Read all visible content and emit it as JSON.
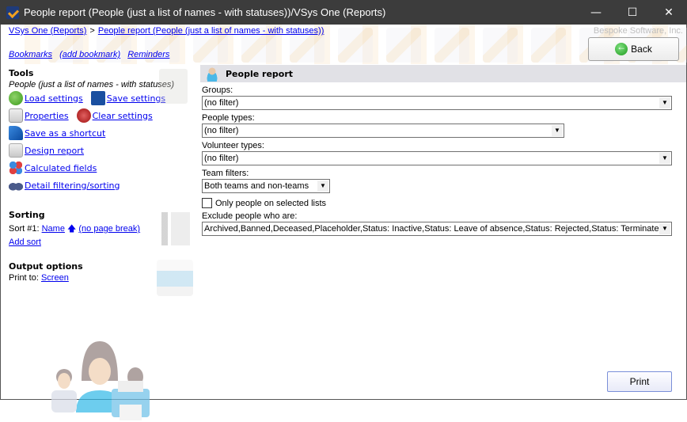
{
  "window": {
    "title": "People report (People (just a list of names - with statuses))/VSys One (Reports)",
    "controls": [
      "minimize",
      "maximize",
      "close"
    ]
  },
  "breadcrumb": {
    "items": [
      "VSys One (Reports)",
      "People report (People (just a list of names - with statuses))"
    ],
    "separator": ">"
  },
  "company": "Bespoke Software, Inc.",
  "bookmarks": {
    "bookmarks": "Bookmarks",
    "add_bookmark": "(add bookmark)",
    "reminders": "Reminders"
  },
  "back_button": "Back",
  "tools": {
    "title": "Tools",
    "subtitle": "People (just a list of names - with statuses)",
    "load_settings": "Load settings",
    "save_settings": "Save settings",
    "properties": "Properties",
    "clear_settings": "Clear settings",
    "save_shortcut": "Save as a shortcut",
    "design_report": "Design report",
    "calculated_fields": "Calculated fields",
    "detail_filtering": "Detail filtering/sorting"
  },
  "sorting": {
    "title": "Sorting",
    "sort1_label": "Sort #1:",
    "sort1_field": "Name",
    "sort1_break": "(no page break)",
    "add_sort": "Add sort"
  },
  "output": {
    "title": "Output options",
    "print_to_label": "Print to:",
    "print_to_value": "Screen"
  },
  "report": {
    "title": "People report",
    "groups_label": "Groups:",
    "groups_value": "(no filter)",
    "people_types_label": "People types:",
    "people_types_value": "(no filter)",
    "volunteer_types_label": "Volunteer types:",
    "volunteer_types_value": "(no filter)",
    "team_filters_label": "Team filters:",
    "team_filters_value": "Both teams and non-teams",
    "only_selected_lists": "Only people on selected lists",
    "only_selected_lists_checked": false,
    "exclude_label": "Exclude people who are:",
    "exclude_value": "Archived,Banned,Deceased,Placeholder,Status: Inactive,Status: Leave of absence,Status: Rejected,Status: Terminated"
  },
  "print_button": "Print"
}
